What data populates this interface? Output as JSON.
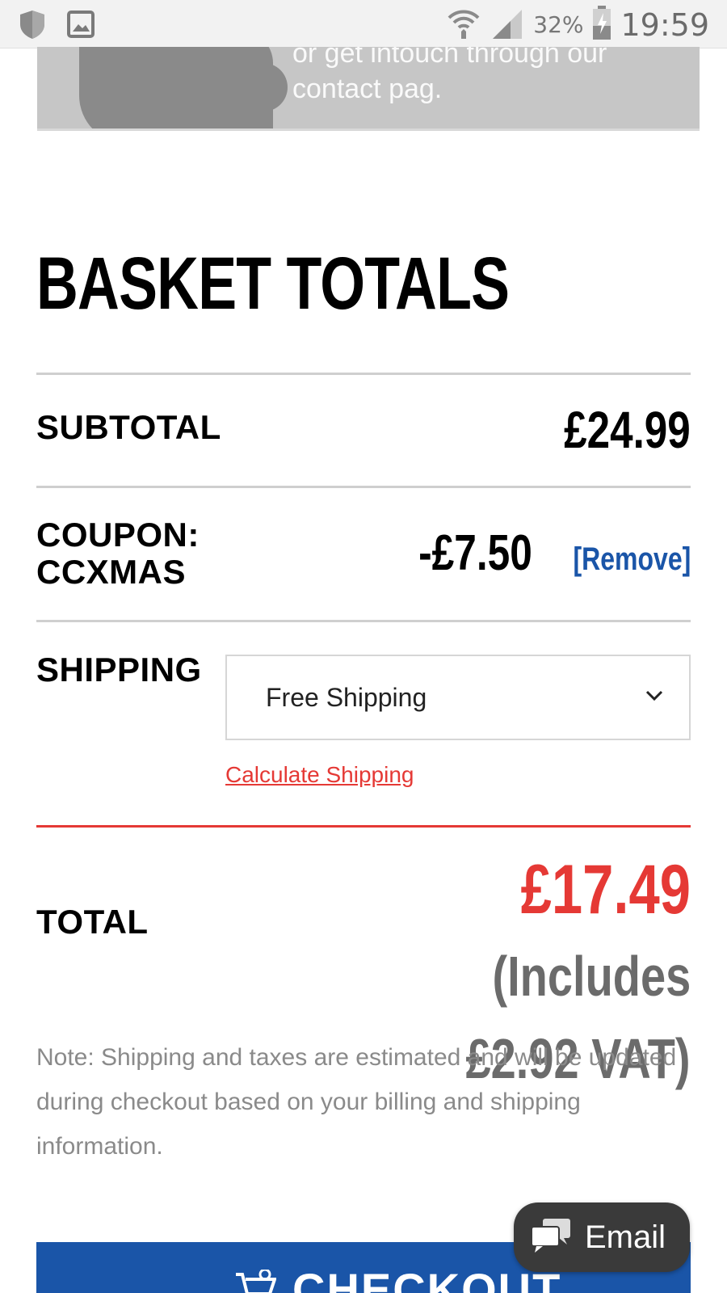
{
  "status_bar": {
    "battery_percent": "32%",
    "time": "19:59",
    "icons": [
      "shield-icon",
      "image-icon",
      "wifi-icon",
      "signal-icon",
      "battery-charging-icon"
    ]
  },
  "banner": {
    "text": "or get intouch through our contact pag."
  },
  "basket": {
    "heading": "BASKET TOTALS",
    "subtotal_label": "SUBTOTAL",
    "subtotal_value": "£24.99",
    "coupon_label_line1": "COUPON:",
    "coupon_label_line2": "CCXMAS",
    "coupon_value": "-£7.50",
    "remove_label": "[Remove]",
    "shipping_label": "SHIPPING",
    "shipping_selected": "Free Shipping",
    "calculate_shipping_label": "Calculate Shipping",
    "total_label": "TOTAL",
    "total_value": "£17.49",
    "vat_line1": "(Includes",
    "vat_line2": "£2.92 VAT)",
    "note": "Note: Shipping and taxes are estimated and will be updated during checkout based on your billing and shipping information."
  },
  "checkout": {
    "label": "CHECKOUT"
  },
  "email_widget": {
    "label": "Email"
  },
  "colors": {
    "accent_red": "#e53935",
    "link_blue": "#1a55a8",
    "checkout_blue": "#1a55a8"
  }
}
